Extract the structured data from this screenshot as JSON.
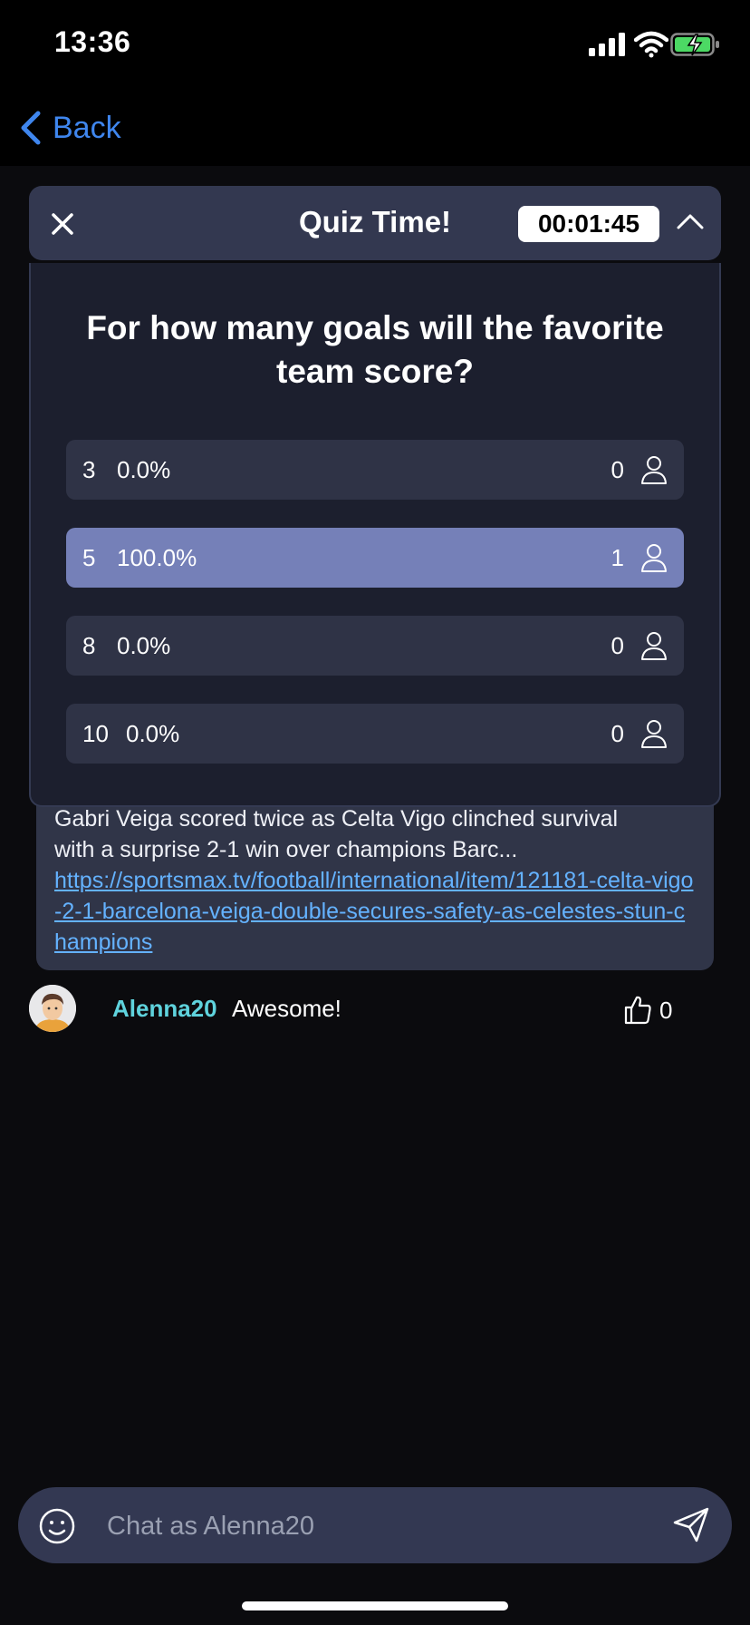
{
  "status_bar": {
    "time": "13:36"
  },
  "nav": {
    "back_label": "Back"
  },
  "quiz": {
    "title": "Quiz Time!",
    "timer": "00:01:45",
    "question": "For how many goals will the favorite team score?",
    "options": [
      {
        "value": "3",
        "percent": "0.0%",
        "count": "0",
        "selected": false
      },
      {
        "value": "5",
        "percent": "100.0%",
        "count": "1",
        "selected": true
      },
      {
        "value": "8",
        "percent": "0.0%",
        "count": "0",
        "selected": false
      },
      {
        "value": "10",
        "percent": "0.0%",
        "count": "0",
        "selected": false
      }
    ]
  },
  "news": {
    "snippet_partial": "Gabri Veiga scored twice as Celta Vigo clinched survival",
    "snippet": "with a surprise 2-1 win over champions Barc...",
    "link": "https://sportsmax.tv/football/international/item/121181-celta-vigo-2-1-barcelona-veiga-double-secures-safety-as-celestes-stun-champions"
  },
  "messages": [
    {
      "user": "Alenna20",
      "text": "Awesome!",
      "likes": "0"
    }
  ],
  "chat_input": {
    "placeholder": "Chat as Alenna20"
  },
  "colors": {
    "accent_blue": "#3f86ee",
    "username": "#5fd3dd",
    "selected_option": "#7580b8",
    "link": "#64b2ff",
    "battery_green": "#4cd964"
  },
  "icons": {
    "close": "close-icon",
    "collapse": "chevron-up-icon",
    "user": "user-icon",
    "like": "thumbs-up-icon",
    "emoji": "smiley-icon",
    "send": "send-icon"
  }
}
